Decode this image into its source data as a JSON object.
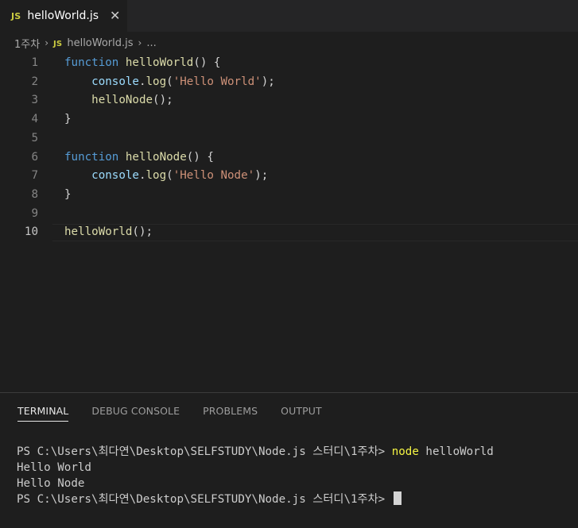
{
  "tab": {
    "badge": "JS",
    "title": "helloWorld.js",
    "close": "✕"
  },
  "breadcrumb": {
    "folder": "1주차",
    "sep": "›",
    "badge": "JS",
    "file": "helloWorld.js",
    "more": "..."
  },
  "editor": {
    "line_numbers": [
      "1",
      "2",
      "3",
      "4",
      "5",
      "6",
      "7",
      "8",
      "9",
      "10"
    ],
    "active_line": 10,
    "lines": [
      [
        {
          "t": "function",
          "c": "kw"
        },
        {
          "t": " ",
          "c": "pl"
        },
        {
          "t": "helloWorld",
          "c": "fn"
        },
        {
          "t": "() {",
          "c": "pl"
        }
      ],
      [
        {
          "t": "    ",
          "c": "pl"
        },
        {
          "t": "console",
          "c": "var"
        },
        {
          "t": ".",
          "c": "pl"
        },
        {
          "t": "log",
          "c": "fn"
        },
        {
          "t": "(",
          "c": "pl"
        },
        {
          "t": "'Hello World'",
          "c": "str"
        },
        {
          "t": ");",
          "c": "pl"
        }
      ],
      [
        {
          "t": "    ",
          "c": "pl"
        },
        {
          "t": "helloNode",
          "c": "fn"
        },
        {
          "t": "();",
          "c": "pl"
        }
      ],
      [
        {
          "t": "}",
          "c": "pl"
        }
      ],
      [],
      [
        {
          "t": "function",
          "c": "kw"
        },
        {
          "t": " ",
          "c": "pl"
        },
        {
          "t": "helloNode",
          "c": "fn"
        },
        {
          "t": "() {",
          "c": "pl"
        }
      ],
      [
        {
          "t": "    ",
          "c": "pl"
        },
        {
          "t": "console",
          "c": "var"
        },
        {
          "t": ".",
          "c": "pl"
        },
        {
          "t": "log",
          "c": "fn"
        },
        {
          "t": "(",
          "c": "pl"
        },
        {
          "t": "'Hello Node'",
          "c": "str"
        },
        {
          "t": ");",
          "c": "pl"
        }
      ],
      [
        {
          "t": "}",
          "c": "pl"
        }
      ],
      [],
      [
        {
          "t": "helloWorld",
          "c": "fn"
        },
        {
          "t": "();",
          "c": "pl"
        }
      ]
    ]
  },
  "panel": {
    "tabs": [
      "TERMINAL",
      "DEBUG CONSOLE",
      "PROBLEMS",
      "OUTPUT"
    ],
    "active_tab": "TERMINAL"
  },
  "terminal": {
    "prompt1": "PS C:\\Users\\최다연\\Desktop\\SELFSTUDY\\Node.js 스터디\\1주차> ",
    "command_keyword": "node",
    "command_arg": " helloWorld",
    "output1": "Hello World",
    "output2": "Hello Node",
    "prompt2": "PS C:\\Users\\최다연\\Desktop\\SELFSTUDY\\Node.js 스터디\\1주차> "
  },
  "colors": {
    "background": "#1e1e1e",
    "keyword": "#569cd6",
    "function": "#dcdcaa",
    "variable": "#9cdcfe",
    "string": "#ce9178",
    "js_badge": "#cbcb41",
    "terminal_command": "#f5f543"
  }
}
